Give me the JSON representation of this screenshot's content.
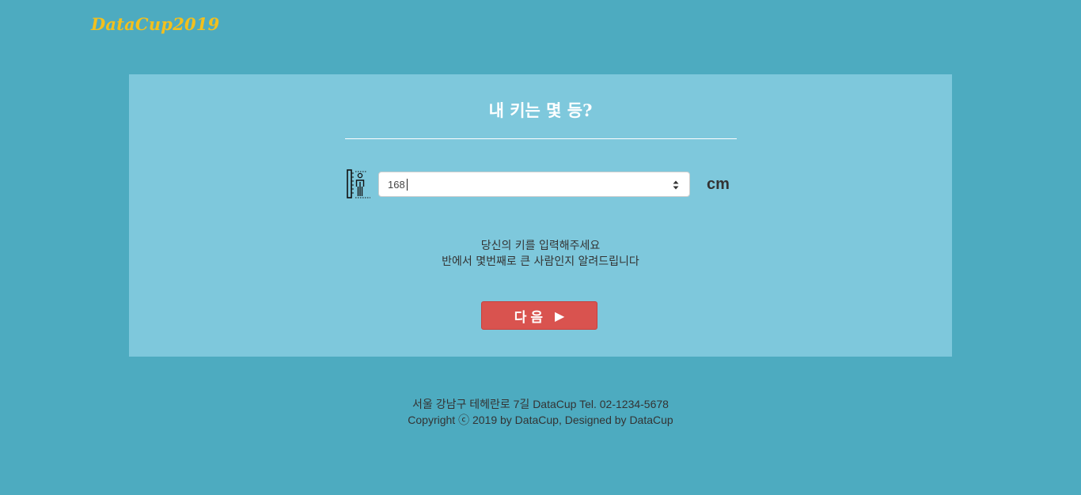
{
  "header": {
    "logo_text": "DataCup2019"
  },
  "card": {
    "title": "내 키는 몇 등?",
    "height_input": {
      "value": "168",
      "unit": "cm",
      "icon": "person-height-ruler-icon"
    },
    "description": [
      "당신의 키를 입력해주세요",
      "반에서 몇번째로 큰 사람인지 알려드립니다"
    ],
    "next_button": {
      "label": "다음",
      "icon": "play-icon",
      "icon_glyph": "▶"
    }
  },
  "footer": {
    "address": "서울 강남구 테헤란로 7길 DataCup Tel. 02-1234-5678",
    "copyright": "Copyright ⓒ 2019 by DataCup, Designed by DataCup"
  },
  "colors": {
    "page_background": "#4dabc0",
    "card_background": "#7ec8dc",
    "logo": "#f2c01e",
    "button": "#d9534f"
  }
}
